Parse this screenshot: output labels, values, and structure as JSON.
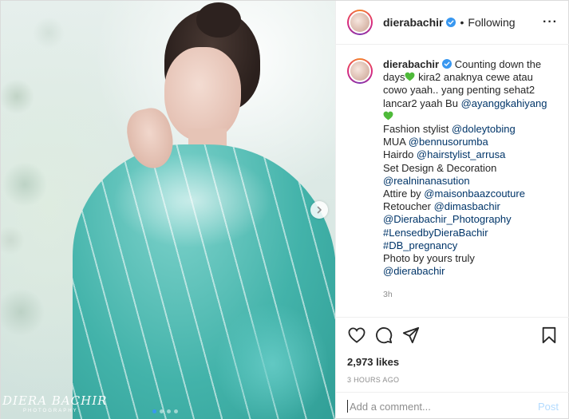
{
  "photo": {
    "watermark_title": "DIERA BACHIR",
    "watermark_subtitle": "PHOTOGRAPHY",
    "carousel_dots": 4,
    "carousel_active_index": 0
  },
  "header": {
    "username": "dierabachir",
    "separator": "•",
    "follow_status": "Following",
    "more_label": "···"
  },
  "caption": {
    "username": "dierabachir",
    "segments": [
      {
        "type": "text",
        "value": "Counting down the days"
      },
      {
        "type": "heart"
      },
      {
        "type": "text",
        "value": " kira2 anaknya cewe atau cowo yaah.. yang penting sehat2 lancar2 yaah Bu "
      },
      {
        "type": "mention",
        "value": "@ayanggkahiyang"
      },
      {
        "type": "br"
      },
      {
        "type": "heart"
      },
      {
        "type": "br"
      },
      {
        "type": "text",
        "value": "Fashion stylist "
      },
      {
        "type": "mention",
        "value": "@doleytobing"
      },
      {
        "type": "br"
      },
      {
        "type": "text",
        "value": "MUA "
      },
      {
        "type": "mention",
        "value": "@bennusorumba"
      },
      {
        "type": "br"
      },
      {
        "type": "text",
        "value": "Hairdo "
      },
      {
        "type": "mention",
        "value": "@hairstylist_arrusa"
      },
      {
        "type": "br"
      },
      {
        "type": "text",
        "value": "Set Design & Decoration"
      },
      {
        "type": "br"
      },
      {
        "type": "mention",
        "value": "@realninanasution"
      },
      {
        "type": "br"
      },
      {
        "type": "text",
        "value": "Attire by "
      },
      {
        "type": "mention",
        "value": "@maisonbaazcouture"
      },
      {
        "type": "br"
      },
      {
        "type": "text",
        "value": "Retoucher "
      },
      {
        "type": "mention",
        "value": "@dimasbachir"
      },
      {
        "type": "br"
      },
      {
        "type": "mention",
        "value": "@Dierabachir_Photography"
      },
      {
        "type": "br"
      },
      {
        "type": "mention",
        "value": "#LensedbyDieraBachir"
      },
      {
        "type": "br"
      },
      {
        "type": "mention",
        "value": "#DB_pregnancy"
      },
      {
        "type": "br"
      },
      {
        "type": "text",
        "value": "Photo by yours truly"
      },
      {
        "type": "br"
      },
      {
        "type": "mention",
        "value": "@dierabachir"
      }
    ],
    "timestamp": "3h"
  },
  "actions": {
    "like_icon": "heart-outline-icon",
    "comment_icon": "comment-bubble-icon",
    "share_icon": "paper-plane-icon",
    "save_icon": "bookmark-icon",
    "likes_text": "2,973 likes",
    "posted_ago": "3 HOURS AGO"
  },
  "comment": {
    "placeholder": "Add a comment...",
    "post_label": "Post"
  },
  "colors": {
    "link": "#003569",
    "verified": "#3897f0",
    "heart": "#4fba3a",
    "post_disabled": "#b3dbff",
    "muted": "#8e8e8e"
  }
}
